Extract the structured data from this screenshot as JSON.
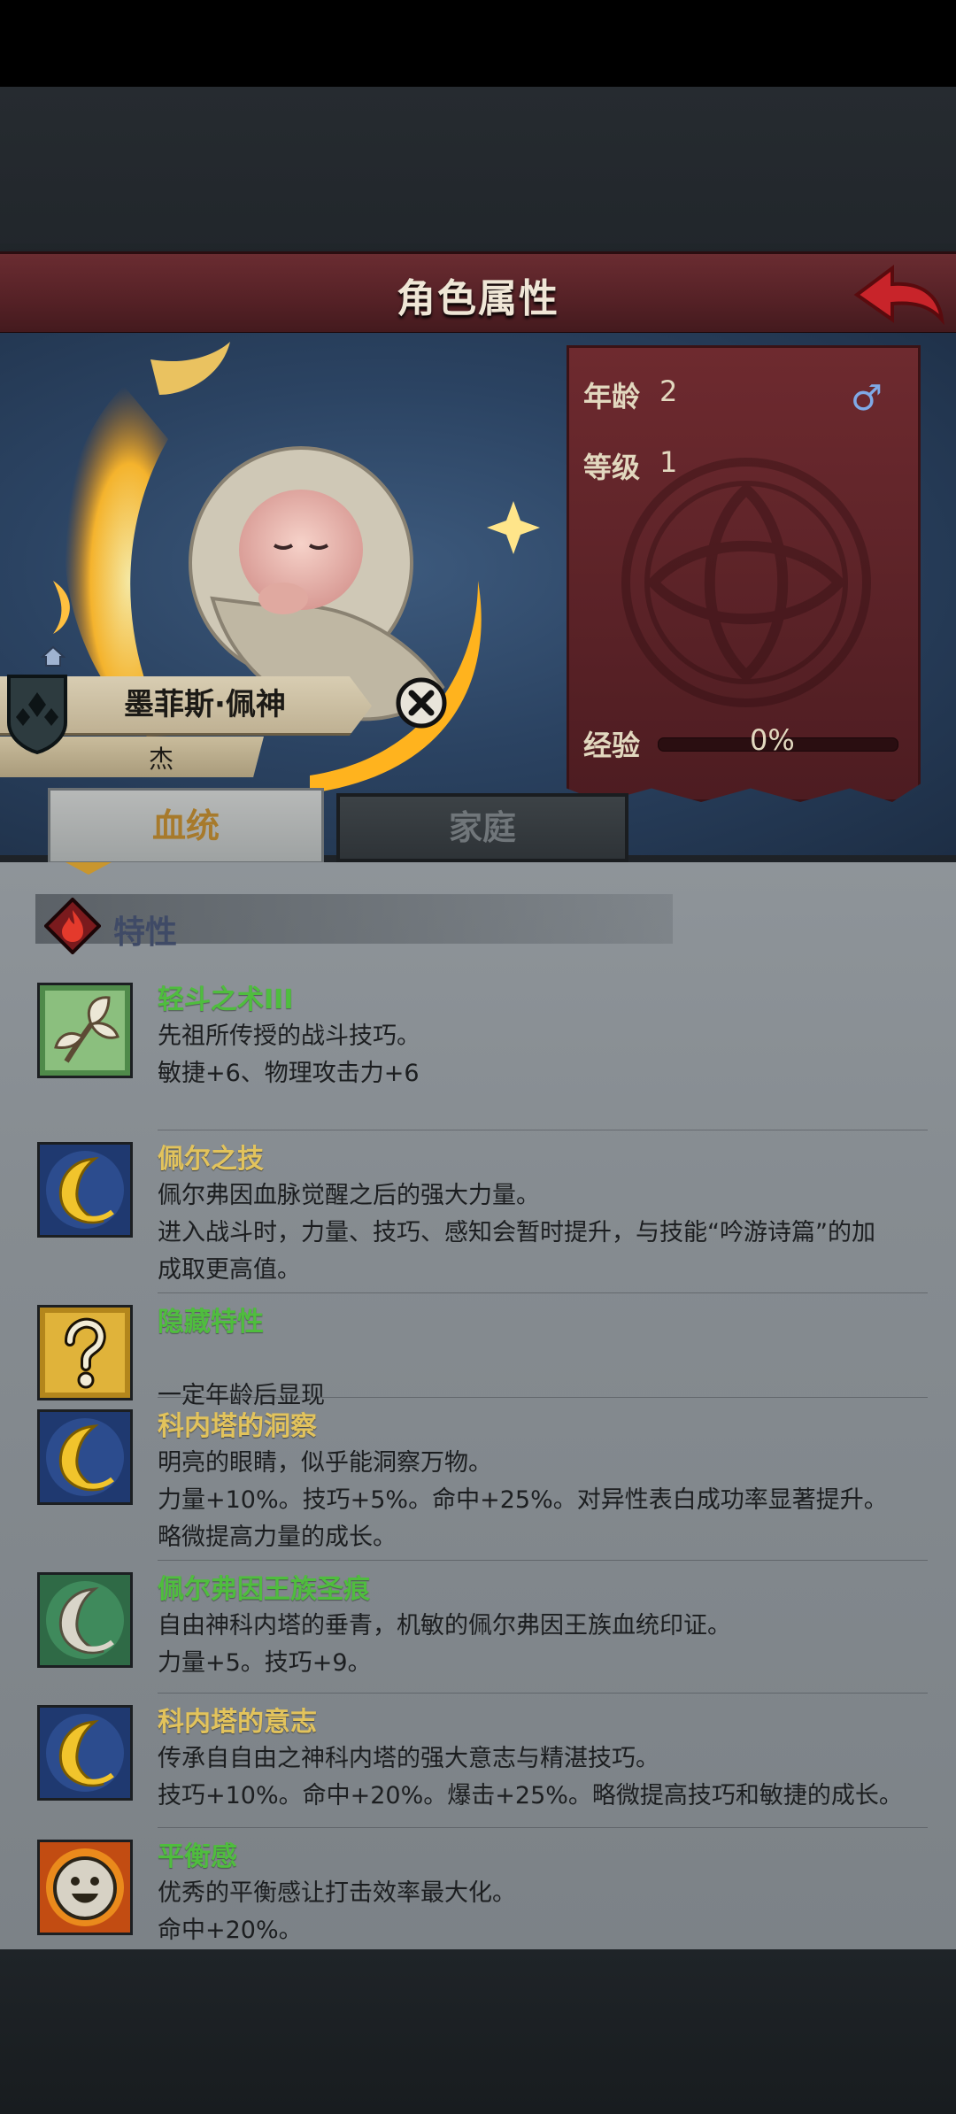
{
  "header": {
    "title": "角色属性"
  },
  "character": {
    "name": "墨菲斯·佩神",
    "subname": "杰",
    "stats": {
      "age_label": "年龄",
      "age_value": "2",
      "level_label": "等级",
      "level_value": "1",
      "exp_label": "经验",
      "exp_value": "0%",
      "exp_fraction": 0
    }
  },
  "tabs": [
    {
      "label": "血统",
      "active": true
    },
    {
      "label": "家庭",
      "active": false
    }
  ],
  "section": {
    "title": "特性"
  },
  "traits": [
    {
      "name": "轻斗之术III",
      "color": "green",
      "icon": "sprout-icon",
      "lines": [
        "先祖所传授的战斗技巧。",
        "敏捷+6、物理攻击力+6"
      ]
    },
    {
      "name": "佩尔之技",
      "color": "gold",
      "icon": "gold-crescent-icon",
      "lines": [
        "佩尔弗因血脉觉醒之后的强大力量。",
        "进入战斗时，力量、技巧、感知会暂时提升，与技能“吟游诗篇”的加",
        "成取更高值。"
      ]
    },
    {
      "name": "隐藏特性",
      "color": "green",
      "icon": "question-icon",
      "lines": [
        "",
        "一定年龄后显现"
      ]
    },
    {
      "name": "科内塔的洞察",
      "color": "gold",
      "icon": "gold-crescent-icon",
      "lines": [
        "明亮的眼睛，似乎能洞察万物。",
        "力量+10%。技巧+5%。命中+25%。对异性表白成功率显著提升。",
        "略微提高力量的成长。"
      ]
    },
    {
      "name": "佩尔弗因王族圣痕",
      "color": "green",
      "icon": "silver-crescent-icon",
      "lines": [
        "自由神科内塔的垂青，机敏的佩尔弗因王族血统印证。",
        "力量+5。技巧+9。"
      ]
    },
    {
      "name": "科内塔的意志",
      "color": "gold",
      "icon": "gold-crescent-icon",
      "lines": [
        "传承自自由之神科内塔的强大意志与精湛技巧。",
        "技巧+10%。命中+20%。爆击+25%。略微提高技巧和敏捷的成长。"
      ]
    },
    {
      "name": "平衡感",
      "color": "green",
      "icon": "smiley-icon",
      "lines": [
        "优秀的平衡感让打击效率最大化。",
        "命中+20%。"
      ]
    }
  ]
}
